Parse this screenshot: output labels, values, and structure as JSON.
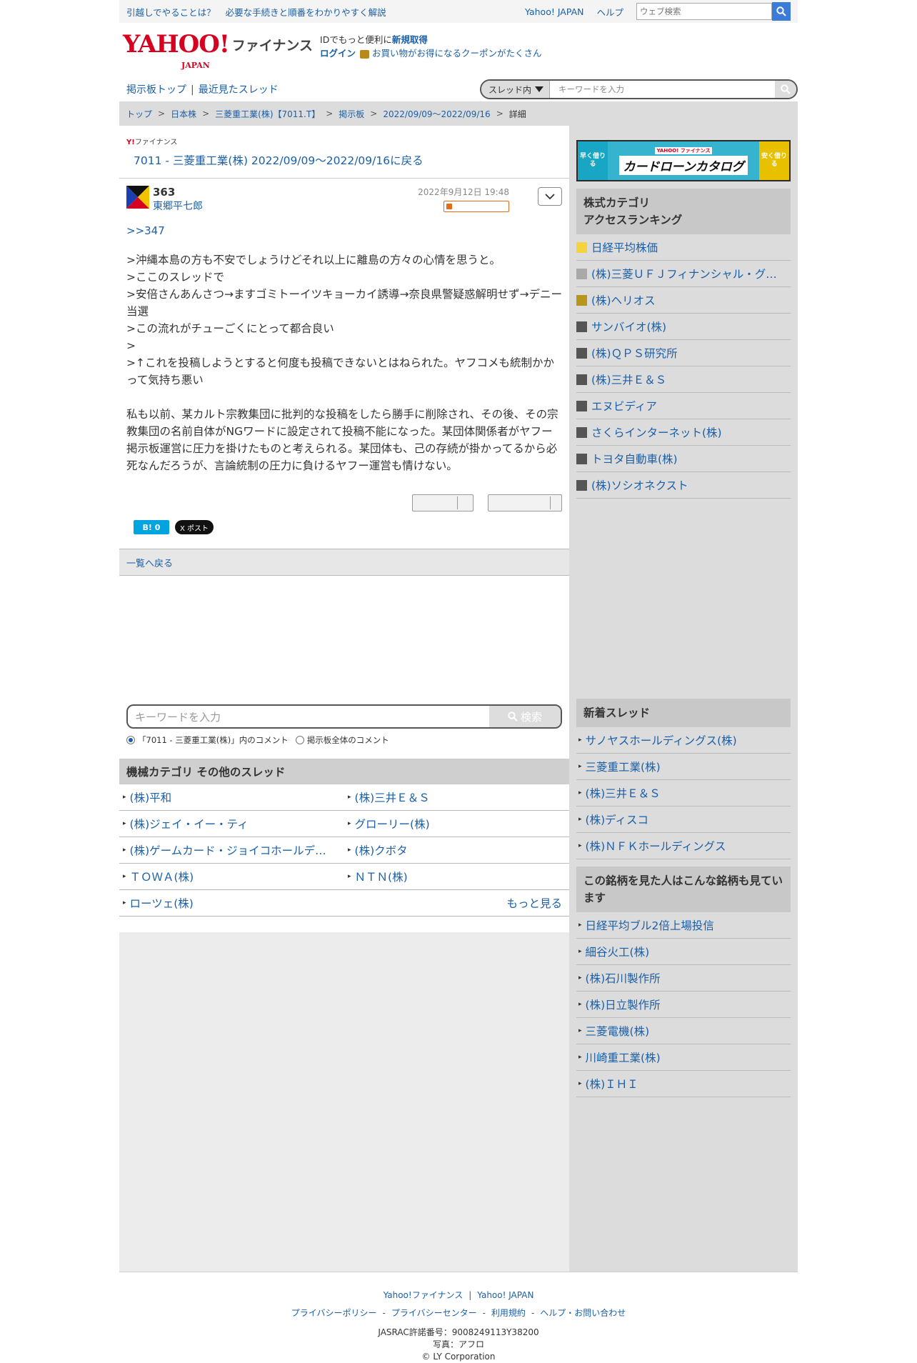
{
  "topbar": {
    "promo_1": "引越しでやることは？",
    "promo_2": "必要な手続きと順番をわかりやすく解説",
    "yahoo_japan": "Yahoo! JAPAN",
    "help": "ヘルプ",
    "web_search_placeholder": "ウェブ検索"
  },
  "header": {
    "logo_text": "YAHOO!",
    "logo_sub": "JAPAN",
    "logo_finance": "ファイナンス",
    "id_text": "IDでもっと便利に",
    "id_link": "新規取得",
    "login": "ログイン",
    "coupon": "お買い物がお得になるクーポンがたくさん"
  },
  "nav": {
    "board_top": "掲示板トップ",
    "separator": "|",
    "recent": "最近見たスレッド",
    "scope_select": "スレッド内",
    "keyword_placeholder": "キーワードを入力"
  },
  "breadcrumb": [
    "トップ",
    "日本株",
    "三菱重工業(株)【7011.T】",
    "掲示板",
    "2022/09/09〜2022/09/16",
    "詳細"
  ],
  "board": {
    "small_brand": "ファイナンス",
    "back_title": "7011 - 三菱重工業(株) 2022/09/09〜2022/09/16に戻る"
  },
  "post": {
    "number": "363",
    "author": "東郷平七郎",
    "date": "2022年9月12日 19:48",
    "anchor": ">>347",
    "body": ">沖縄本島の方も不安でしょうけどそれ以上に離島の方々の心情を思うと。\n>ここのスレッドで\n>安倍さんあんさつ→ますゴミトーイツキョーカイ誘導→奈良県警疑惑解明せず→デニー当選\n>この流れがチューごくにとって都合良い\n>\n>↑これを投稿しようとすると何度も投稿できないとはねられた。ヤフコメも統制かかって気持ち悪い\n\n私も以前、某カルト宗教集団に批判的な投稿をしたら勝手に削除され、その後、その宗教集団の名前自体がNGワードに設定されて投稿不能になった。某団体関係者がヤフー掲示板運営に圧力を掛けたものと考えられる。某団体も、己の存続が掛かってるから必死なんだろうが、言論統制の圧力に負けるヤフー運営も情けない。",
    "hatena_label": "B! 0",
    "x_label": "X ポスト"
  },
  "list_back": "一覧へ戻る",
  "search": {
    "placeholder": "キーワードを入力",
    "button": "検索",
    "radio_thread": "「7011 - 三菱重工業(株)」内のコメント",
    "radio_all": "掲示板全体のコメント"
  },
  "category": {
    "title": "機械カテゴリ  その他のスレッド",
    "items": [
      "(株)平和",
      "(株)三井Ｅ＆Ｓ",
      "(株)ジェイ・イー・ティ",
      "グローリー(株)",
      "(株)ゲームカード・ジョイコホールデ…",
      "(株)クボタ",
      "ＴＯＷＡ(株)",
      "ＮＴＮ(株)",
      "ローツェ(株)"
    ],
    "more": "もっと見る"
  },
  "sidebar": {
    "ad": {
      "left": "早く借りる",
      "brand": "YAHOO! ファイナンス",
      "title": "カードローンカタログ",
      "right": "安く借りる"
    },
    "ranking_title": "株式カテゴリ\nアクセスランキング",
    "ranking": [
      {
        "name": "日経平均株価",
        "color": "#f5d33a"
      },
      {
        "name": "(株)三菱ＵＦＪフィナンシャル・グ…",
        "color": "#a9a9a9"
      },
      {
        "name": "(株)ヘリオス",
        "color": "#b8961c"
      },
      {
        "name": "サンバイオ(株)",
        "color": "#555555"
      },
      {
        "name": "(株)ＱＰＳ研究所",
        "color": "#555555"
      },
      {
        "name": "(株)三井Ｅ＆Ｓ",
        "color": "#555555"
      },
      {
        "name": "エヌビディア",
        "color": "#555555"
      },
      {
        "name": "さくらインターネット(株)",
        "color": "#555555"
      },
      {
        "name": "トヨタ自動車(株)",
        "color": "#555555"
      },
      {
        "name": "(株)ソシオネクスト",
        "color": "#555555"
      }
    ],
    "new_threads_title": "新着スレッド",
    "new_threads": [
      "サノヤスホールディングス(株)",
      "三菱重工業(株)",
      "(株)三井Ｅ＆Ｓ",
      "(株)ディスコ",
      "(株)ＮＦＫホールディングス"
    ],
    "also_viewed_title": "この銘柄を見た人はこんな銘柄も見ています",
    "also_viewed": [
      "日経平均ブル2倍上場投信",
      "細谷火工(株)",
      "(株)石川製作所",
      "(株)日立製作所",
      "三菱電機(株)",
      "川崎重工業(株)",
      "(株)ＩＨＩ"
    ]
  },
  "footer": {
    "yf": "Yahoo!ファイナンス",
    "yj": "Yahoo! JAPAN",
    "privacy_policy": "プライバシーポリシー",
    "privacy_center": "プライバシーセンター",
    "terms": "利用規約",
    "help": "ヘルプ・お問い合わせ",
    "jasrac": "JASRAC許諾番号：9008249113Y38200",
    "photo": "写真：アフロ",
    "copyright": "© LY Corporation"
  }
}
